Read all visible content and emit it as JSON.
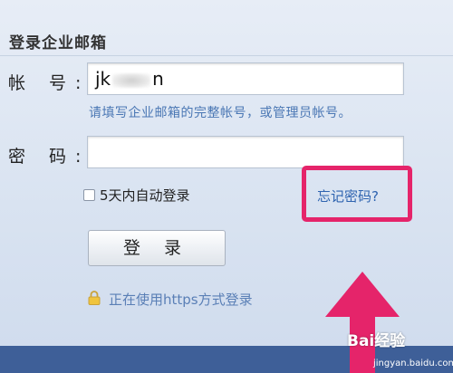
{
  "form": {
    "title": "登录企业邮箱",
    "account_label": "帐 号:",
    "account_value_start": "jk",
    "account_value_end": "n",
    "account_hint": "请填写企业邮箱的完整帐号，或管理员帐号。",
    "password_label": "密 码:",
    "password_value": "",
    "remember_label": "5天内自动登录",
    "remember_checked": false,
    "forgot_link": "忘记密码?",
    "login_button": "登 录",
    "secure_text": "正在使用https方式登录"
  },
  "colors": {
    "highlight_box": "#e5246a",
    "arrow": "#e5246a",
    "link": "#2f64b0",
    "bottom_bar": "#3e5f98"
  },
  "watermark": {
    "brand": "Bai经验",
    "url": "jingyan.baidu.com"
  }
}
